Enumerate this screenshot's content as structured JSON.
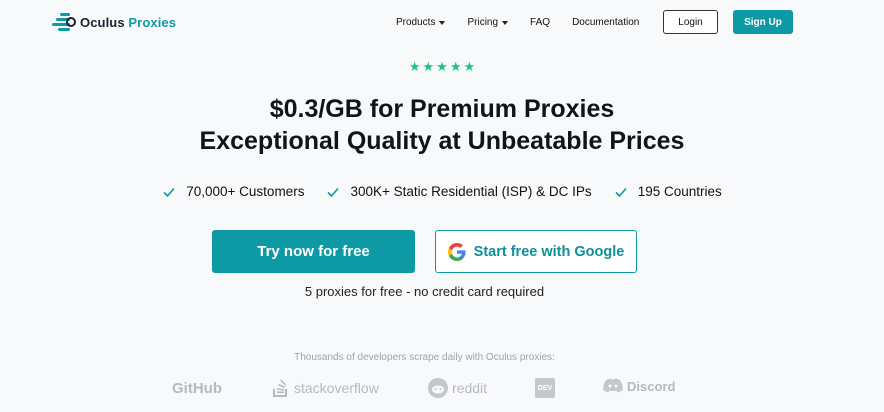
{
  "header": {
    "logo_text_main": "Oculus",
    "logo_text_accent": "Proxies",
    "nav": [
      {
        "label": "Products",
        "has_caret": true
      },
      {
        "label": "Pricing",
        "has_caret": true
      },
      {
        "label": "FAQ",
        "has_caret": false
      },
      {
        "label": "Documentation",
        "has_caret": false
      }
    ],
    "login_label": "Login",
    "signup_label": "Sign Up"
  },
  "hero": {
    "rating_stars": 5,
    "headline_line1": "$0.3/GB for Premium Proxies",
    "headline_line2": "Exceptional Quality at Unbeatable Prices",
    "features": [
      "70,000+ Customers",
      "300K+ Static Residential (ISP) & DC IPs",
      "195 Countries"
    ],
    "cta_primary": "Try now for free",
    "cta_google": "Start free with Google",
    "note": "5 proxies for free - no credit card required"
  },
  "trust": {
    "caption": "Thousands of developers scrape daily with Oculus proxies:",
    "brands": [
      "GitHub",
      "stackoverflow",
      "reddit",
      "DEV",
      "Discord"
    ]
  },
  "colors": {
    "brand": "#0e9aa5",
    "star": "#1ec28b",
    "background": "#f8f9fb"
  }
}
